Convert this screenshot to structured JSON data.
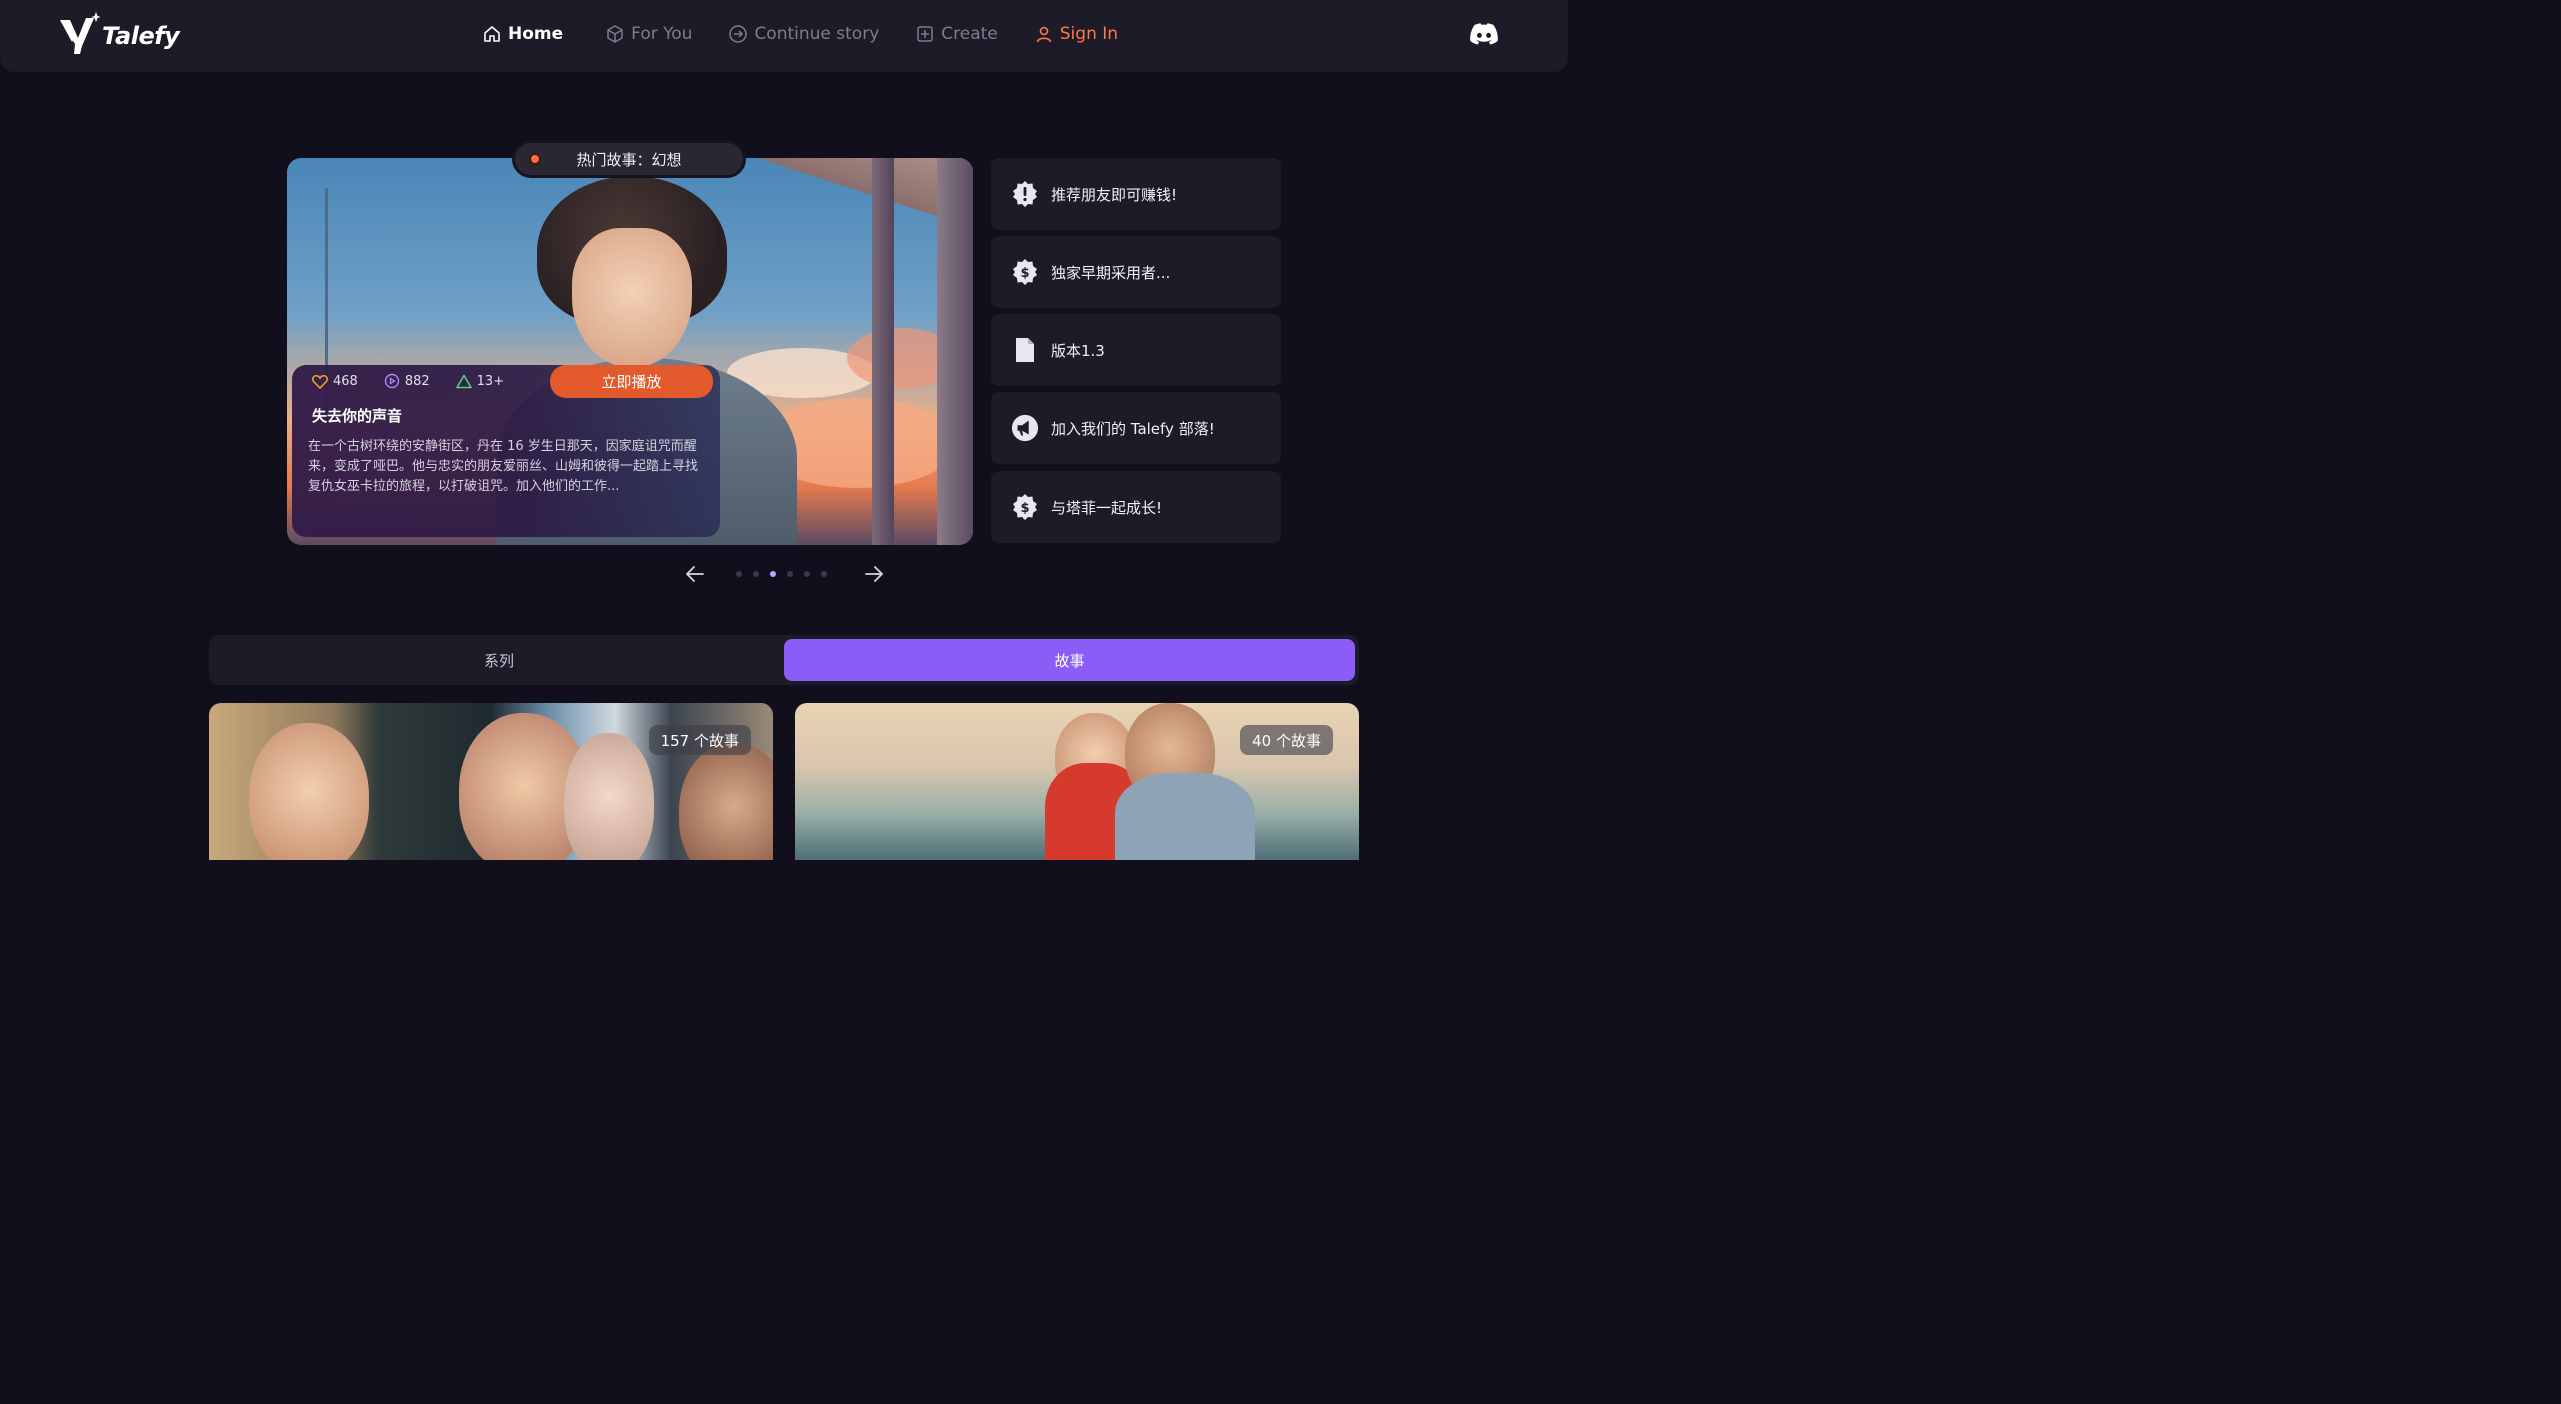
{
  "header": {
    "logo_text": "Talefy",
    "nav": [
      {
        "label": "Home",
        "icon": "home-icon"
      },
      {
        "label": "For You",
        "icon": "cube-icon"
      },
      {
        "label": "Continue story",
        "icon": "arrow-circle-icon"
      },
      {
        "label": "Create",
        "icon": "plus-square-icon"
      },
      {
        "label": "Sign In",
        "icon": "user-icon"
      }
    ],
    "discord_icon": "discord-icon"
  },
  "hero": {
    "tag": "热门故事：幻想",
    "likes": "468",
    "plays": "882",
    "age_rating": "13+",
    "play_button": "立即播放",
    "title": "失去你的声音",
    "description": "在一个古树环绕的安静街区，丹在 16 岁生日那天，因家庭诅咒而醒来，变成了哑巴。他与忠实的朋友爱丽丝、山姆和彼得一起踏上寻找复仇女巫卡拉的旅程，以打破诅咒。加入他们的工作..."
  },
  "side_list": [
    {
      "label": "推荐朋友即可赚钱!",
      "icon": "alert-badge-icon"
    },
    {
      "label": "独家早期采用者...",
      "icon": "dollar-badge-icon"
    },
    {
      "label": "版本1.3",
      "icon": "document-icon"
    },
    {
      "label": "加入我们的 Talefy 部落!",
      "icon": "megaphone-icon"
    },
    {
      "label": "与塔菲一起成长!",
      "icon": "dollar-badge-icon"
    }
  ],
  "carousel": {
    "active_index": 2,
    "total": 6
  },
  "tabs": {
    "series": "系列",
    "stories": "故事",
    "active": "stories"
  },
  "cards": [
    {
      "count": "157 个故事"
    },
    {
      "count": "40 个故事"
    }
  ],
  "colors": {
    "background": "#110f1c",
    "accent_orange": "#e25a2c",
    "accent_purple": "#8b5cf6",
    "signin_orange": "#ff7a45"
  }
}
